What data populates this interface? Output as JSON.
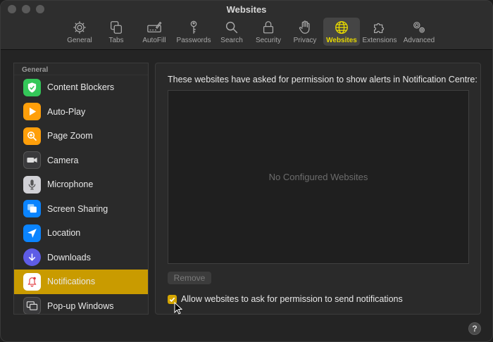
{
  "window": {
    "title": "Websites"
  },
  "toolbar": {
    "items": [
      {
        "label": "General",
        "icon": "gear-icon"
      },
      {
        "label": "Tabs",
        "icon": "tabs-icon"
      },
      {
        "label": "AutoFill",
        "icon": "autofill-icon"
      },
      {
        "label": "Passwords",
        "icon": "key-icon"
      },
      {
        "label": "Search",
        "icon": "magnifier-icon"
      },
      {
        "label": "Security",
        "icon": "lock-icon"
      },
      {
        "label": "Privacy",
        "icon": "hand-icon"
      },
      {
        "label": "Websites",
        "icon": "globe-icon",
        "active": true
      },
      {
        "label": "Extensions",
        "icon": "puzzle-icon"
      },
      {
        "label": "Advanced",
        "icon": "gears-icon"
      }
    ]
  },
  "sidebar": {
    "header": "General",
    "items": [
      {
        "label": "Content Blockers",
        "icon": "shield-icon",
        "color": "#34c759"
      },
      {
        "label": "Auto-Play",
        "icon": "play-icon",
        "color": "#ff9f0a"
      },
      {
        "label": "Page Zoom",
        "icon": "zoom-icon",
        "color": "#ff9f0a"
      },
      {
        "label": "Camera",
        "icon": "camera-icon",
        "color": "#3a3a3c"
      },
      {
        "label": "Microphone",
        "icon": "microphone-icon",
        "color": "#d1d1d6"
      },
      {
        "label": "Screen Sharing",
        "icon": "screen-sharing-icon",
        "color": "#0a84ff"
      },
      {
        "label": "Location",
        "icon": "location-arrow-icon",
        "color": "#0a84ff"
      },
      {
        "label": "Downloads",
        "icon": "download-icon",
        "color": "#5e5ce6"
      },
      {
        "label": "Notifications",
        "icon": "bell-icon",
        "color": "#ffffff",
        "selected": true
      },
      {
        "label": "Pop-up Windows",
        "icon": "popup-windows-icon",
        "color": "#3a3a3c"
      }
    ]
  },
  "main": {
    "description": "These websites have asked for permission to show alerts in Notification Centre:",
    "empty_message": "No Configured Websites",
    "remove_label": "Remove",
    "allow_label": "Allow websites to ask for permission to send notifications",
    "allow_checked": true
  },
  "help": {
    "label": "?"
  },
  "colors": {
    "accent": "#c99b00",
    "active_label": "#e6d800"
  }
}
